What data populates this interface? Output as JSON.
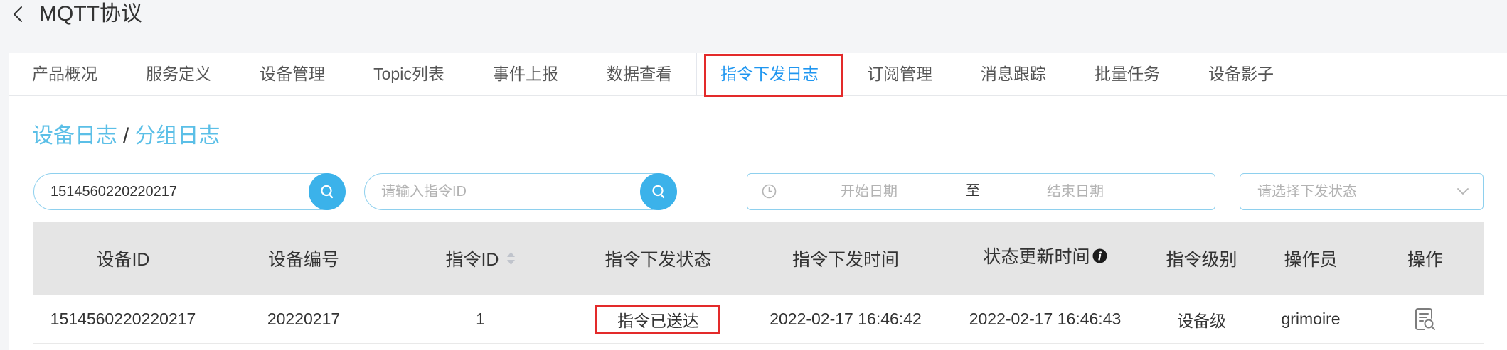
{
  "header": {
    "back_icon": "chevron-left-icon",
    "title": "MQTT协议"
  },
  "tabs": [
    {
      "label": "产品概况",
      "active": false
    },
    {
      "label": "服务定义",
      "active": false
    },
    {
      "label": "设备管理",
      "active": false
    },
    {
      "label": "Topic列表",
      "active": false
    },
    {
      "label": "事件上报",
      "active": false
    },
    {
      "label": "数据查看",
      "active": false
    },
    {
      "label": "指令下发日志",
      "active": true
    },
    {
      "label": "订阅管理",
      "active": false
    },
    {
      "label": "消息跟踪",
      "active": false
    },
    {
      "label": "批量任务",
      "active": false
    },
    {
      "label": "设备影子",
      "active": false
    }
  ],
  "breadcrumb": {
    "items": [
      "设备日志",
      "分组日志"
    ],
    "separator": "/"
  },
  "filters": {
    "device_id_search": {
      "value": "1514560220220217",
      "button_icon": "search-icon"
    },
    "command_id_search": {
      "placeholder": "请输入指令ID",
      "button_icon": "search-icon"
    },
    "date_range": {
      "icon": "clock-icon",
      "start_placeholder": "开始日期",
      "separator": "至",
      "end_placeholder": "结束日期"
    },
    "status_select": {
      "placeholder": "请选择下发状态",
      "icon": "chevron-down-icon"
    }
  },
  "table": {
    "columns": [
      {
        "label": "设备ID"
      },
      {
        "label": "设备编号"
      },
      {
        "label": "指令ID",
        "sortable": true,
        "icon": "sort-icon"
      },
      {
        "label": "指令下发状态"
      },
      {
        "label": "指令下发时间"
      },
      {
        "label": "状态更新时间",
        "icon": "info-icon"
      },
      {
        "label": "指令级别"
      },
      {
        "label": "操作员"
      },
      {
        "label": "操作"
      }
    ],
    "rows": [
      {
        "device_id": "1514560220220217",
        "device_number": "20220217",
        "command_id": "1",
        "status": "指令已送达",
        "sent_time": "2022-02-17 16:46:42",
        "updated_time": "2022-02-17 16:46:43",
        "level": "设备级",
        "operator": "grimoire",
        "action_icon": "view-detail-icon"
      }
    ]
  },
  "colors": {
    "accent": "#1f96f0",
    "breadcrumb_link": "#5bbfe7",
    "search_button": "#3bb2ea",
    "input_border": "#8ed0ee",
    "table_header_bg": "#e5e5e5",
    "annotation": "#e32a2a"
  }
}
